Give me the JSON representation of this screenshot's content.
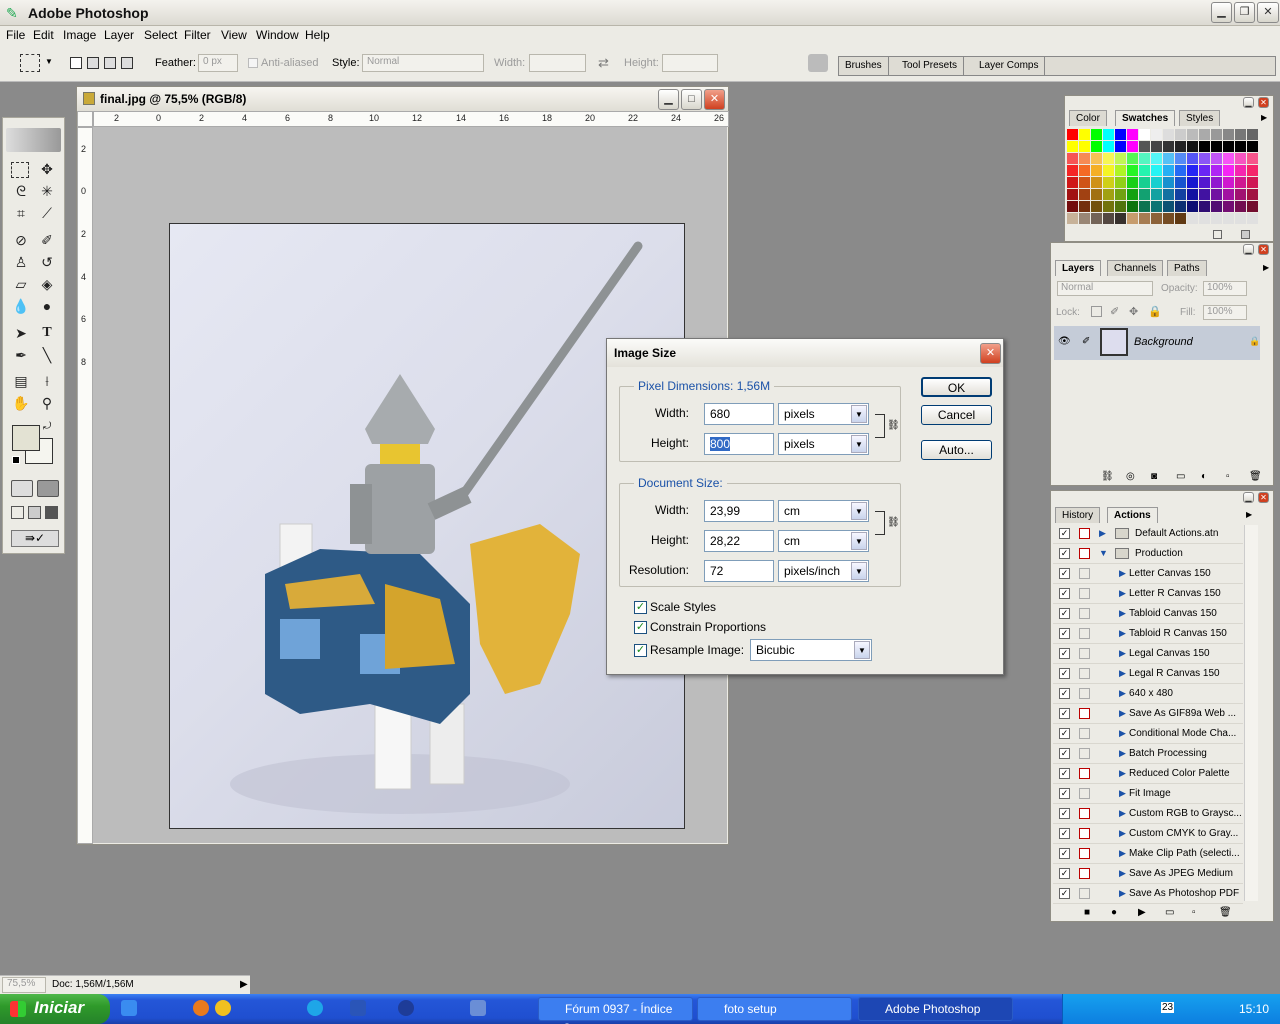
{
  "app": {
    "title": "Adobe Photoshop"
  },
  "menu": [
    "File",
    "Edit",
    "Image",
    "Layer",
    "Select",
    "Filter",
    "View",
    "Window",
    "Help"
  ],
  "options": {
    "feather_label": "Feather:",
    "feather_value": "0 px",
    "antialiased_label": "Anti-aliased",
    "style_label": "Style:",
    "style_value": "Normal",
    "width_label": "Width:",
    "height_label": "Height:"
  },
  "wells": [
    "Brushes",
    "Tool Presets",
    "Layer Comps"
  ],
  "document": {
    "title": "final.jpg @ 75,5% (RGB/8)",
    "h_ticks": [
      "2",
      "0",
      "2",
      "4",
      "6",
      "8",
      "10",
      "12",
      "14",
      "16",
      "18",
      "20",
      "22",
      "24",
      "26"
    ],
    "v_ticks": [
      "2",
      "0",
      "2",
      "4",
      "6",
      "8",
      "1\n0",
      "1\n2",
      "1\n4",
      "1\n6",
      "1\n8",
      "2\n0",
      "2\n2",
      "2\n4",
      "2\n6",
      "2\n8",
      "3\n0"
    ]
  },
  "dialog": {
    "title": "Image Size",
    "pixel_dimensions_label": "Pixel Dimensions:",
    "pixel_dimensions_value": "1,56M",
    "px_width_label": "Width:",
    "px_width_value": "680",
    "px_width_unit": "pixels",
    "px_height_label": "Height:",
    "px_height_value": "800",
    "px_height_unit": "pixels",
    "document_size_label": "Document Size:",
    "doc_width_label": "Width:",
    "doc_width_value": "23,99",
    "doc_width_unit": "cm",
    "doc_height_label": "Height:",
    "doc_height_value": "28,22",
    "doc_height_unit": "cm",
    "resolution_label": "Resolution:",
    "resolution_value": "72",
    "resolution_unit": "pixels/inch",
    "scale_styles": "Scale Styles",
    "constrain": "Constrain Proportions",
    "resample": "Resample Image:",
    "resample_value": "Bicubic",
    "ok": "OK",
    "cancel": "Cancel",
    "auto": "Auto..."
  },
  "color_panel": {
    "tabs": [
      "Color",
      "Swatches",
      "Styles"
    ]
  },
  "layers_panel": {
    "tabs": [
      "Layers",
      "Channels",
      "Paths"
    ],
    "blend": "Normal",
    "opacity_label": "Opacity:",
    "opacity_value": "100%",
    "lock_label": "Lock:",
    "fill_label": "Fill:",
    "fill_value": "100%",
    "layer_name": "Background"
  },
  "actions_panel": {
    "tabs": [
      "History",
      "Actions"
    ],
    "items": [
      {
        "name": "Default Actions.atn",
        "level": 0,
        "red": true
      },
      {
        "name": "Production",
        "level": 0,
        "red": true
      },
      {
        "name": "Letter Canvas 150",
        "level": 1,
        "red": false
      },
      {
        "name": "Letter R Canvas 150",
        "level": 1,
        "red": false
      },
      {
        "name": "Tabloid Canvas 150",
        "level": 1,
        "red": false
      },
      {
        "name": "Tabloid R Canvas 150",
        "level": 1,
        "red": false
      },
      {
        "name": "Legal Canvas 150",
        "level": 1,
        "red": false
      },
      {
        "name": "Legal R Canvas 150",
        "level": 1,
        "red": false
      },
      {
        "name": "640 x 480",
        "level": 1,
        "red": false
      },
      {
        "name": "Save As GIF89a Web ...",
        "level": 1,
        "red": true
      },
      {
        "name": "Conditional Mode Cha...",
        "level": 1,
        "red": false
      },
      {
        "name": "Batch Processing",
        "level": 1,
        "red": false
      },
      {
        "name": "Reduced Color Palette",
        "level": 1,
        "red": true
      },
      {
        "name": "Fit Image",
        "level": 1,
        "red": false
      },
      {
        "name": "Custom RGB to Graysc...",
        "level": 1,
        "red": true
      },
      {
        "name": "Custom CMYK to Gray...",
        "level": 1,
        "red": true
      },
      {
        "name": "Make Clip Path (selecti...",
        "level": 1,
        "red": true
      },
      {
        "name": "Save As JPEG Medium",
        "level": 1,
        "red": true
      },
      {
        "name": "Save As Photoshop PDF",
        "level": 1,
        "red": false
      }
    ]
  },
  "status": {
    "zoom": "75,5%",
    "doc": "Doc: 1,56M/1,56M"
  },
  "taskbar": {
    "start": "Iniciar",
    "tasks": [
      "Fórum 0937 - Índice -...",
      "foto setup",
      "Adobe Photoshop"
    ],
    "clock": "15:10",
    "tray_date": "23"
  }
}
